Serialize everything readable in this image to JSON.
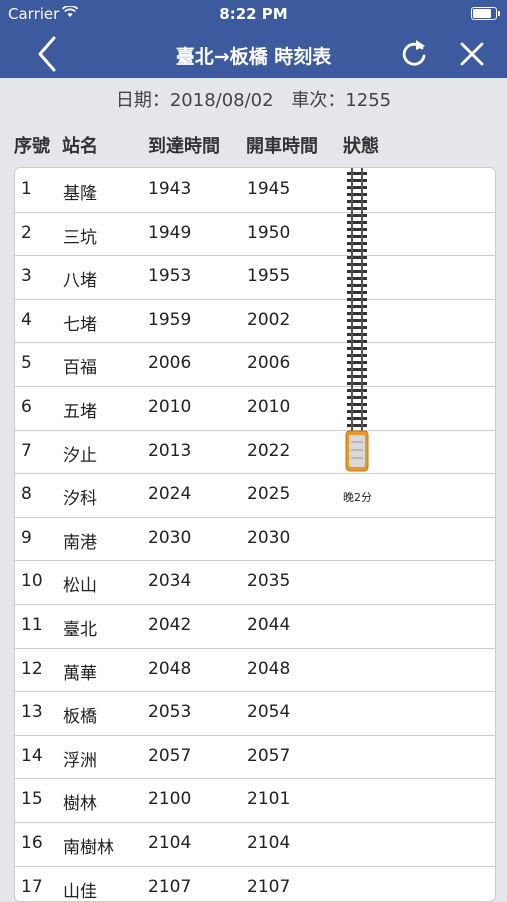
{
  "status_bar": {
    "carrier": "Carrier",
    "time": "8:22 PM"
  },
  "nav": {
    "title": "臺北→板橋 時刻表"
  },
  "info": {
    "date": "日期：2018/08/02",
    "train": "車次：1255"
  },
  "headers": {
    "seq": "序號",
    "station": "站名",
    "arrival": "到達時間",
    "departure": "開車時間",
    "status": "狀態"
  },
  "rows": [
    {
      "seq": "1",
      "station": "基隆",
      "arr": "1943",
      "dep": "1945",
      "status": ""
    },
    {
      "seq": "2",
      "station": "三坑",
      "arr": "1949",
      "dep": "1950",
      "status": ""
    },
    {
      "seq": "3",
      "station": "八堵",
      "arr": "1953",
      "dep": "1955",
      "status": ""
    },
    {
      "seq": "4",
      "station": "七堵",
      "arr": "1959",
      "dep": "2002",
      "status": ""
    },
    {
      "seq": "5",
      "station": "百福",
      "arr": "2006",
      "dep": "2006",
      "status": ""
    },
    {
      "seq": "6",
      "station": "五堵",
      "arr": "2010",
      "dep": "2010",
      "status": ""
    },
    {
      "seq": "7",
      "station": "汐止",
      "arr": "2013",
      "dep": "2022",
      "status": ""
    },
    {
      "seq": "8",
      "station": "汐科",
      "arr": "2024",
      "dep": "2025",
      "status": "晚2分"
    },
    {
      "seq": "9",
      "station": "南港",
      "arr": "2030",
      "dep": "2030",
      "status": ""
    },
    {
      "seq": "10",
      "station": "松山",
      "arr": "2034",
      "dep": "2035",
      "status": ""
    },
    {
      "seq": "11",
      "station": "臺北",
      "arr": "2042",
      "dep": "2044",
      "status": ""
    },
    {
      "seq": "12",
      "station": "萬華",
      "arr": "2048",
      "dep": "2048",
      "status": ""
    },
    {
      "seq": "13",
      "station": "板橋",
      "arr": "2053",
      "dep": "2054",
      "status": ""
    },
    {
      "seq": "14",
      "station": "浮洲",
      "arr": "2057",
      "dep": "2057",
      "status": ""
    },
    {
      "seq": "15",
      "station": "樹林",
      "arr": "2100",
      "dep": "2101",
      "status": ""
    },
    {
      "seq": "16",
      "station": "南樹林",
      "arr": "2104",
      "dep": "2104",
      "status": ""
    },
    {
      "seq": "17",
      "station": "山佳",
      "arr": "2107",
      "dep": "2107",
      "status": ""
    }
  ],
  "icons": [
    "wifi-icon",
    "battery-icon",
    "back-icon",
    "refresh-icon",
    "close-icon",
    "track-icon",
    "train-icon"
  ],
  "colors": {
    "nav": "#3d5a9e",
    "background": "#e4e6ea",
    "train": "#e79a2c"
  }
}
